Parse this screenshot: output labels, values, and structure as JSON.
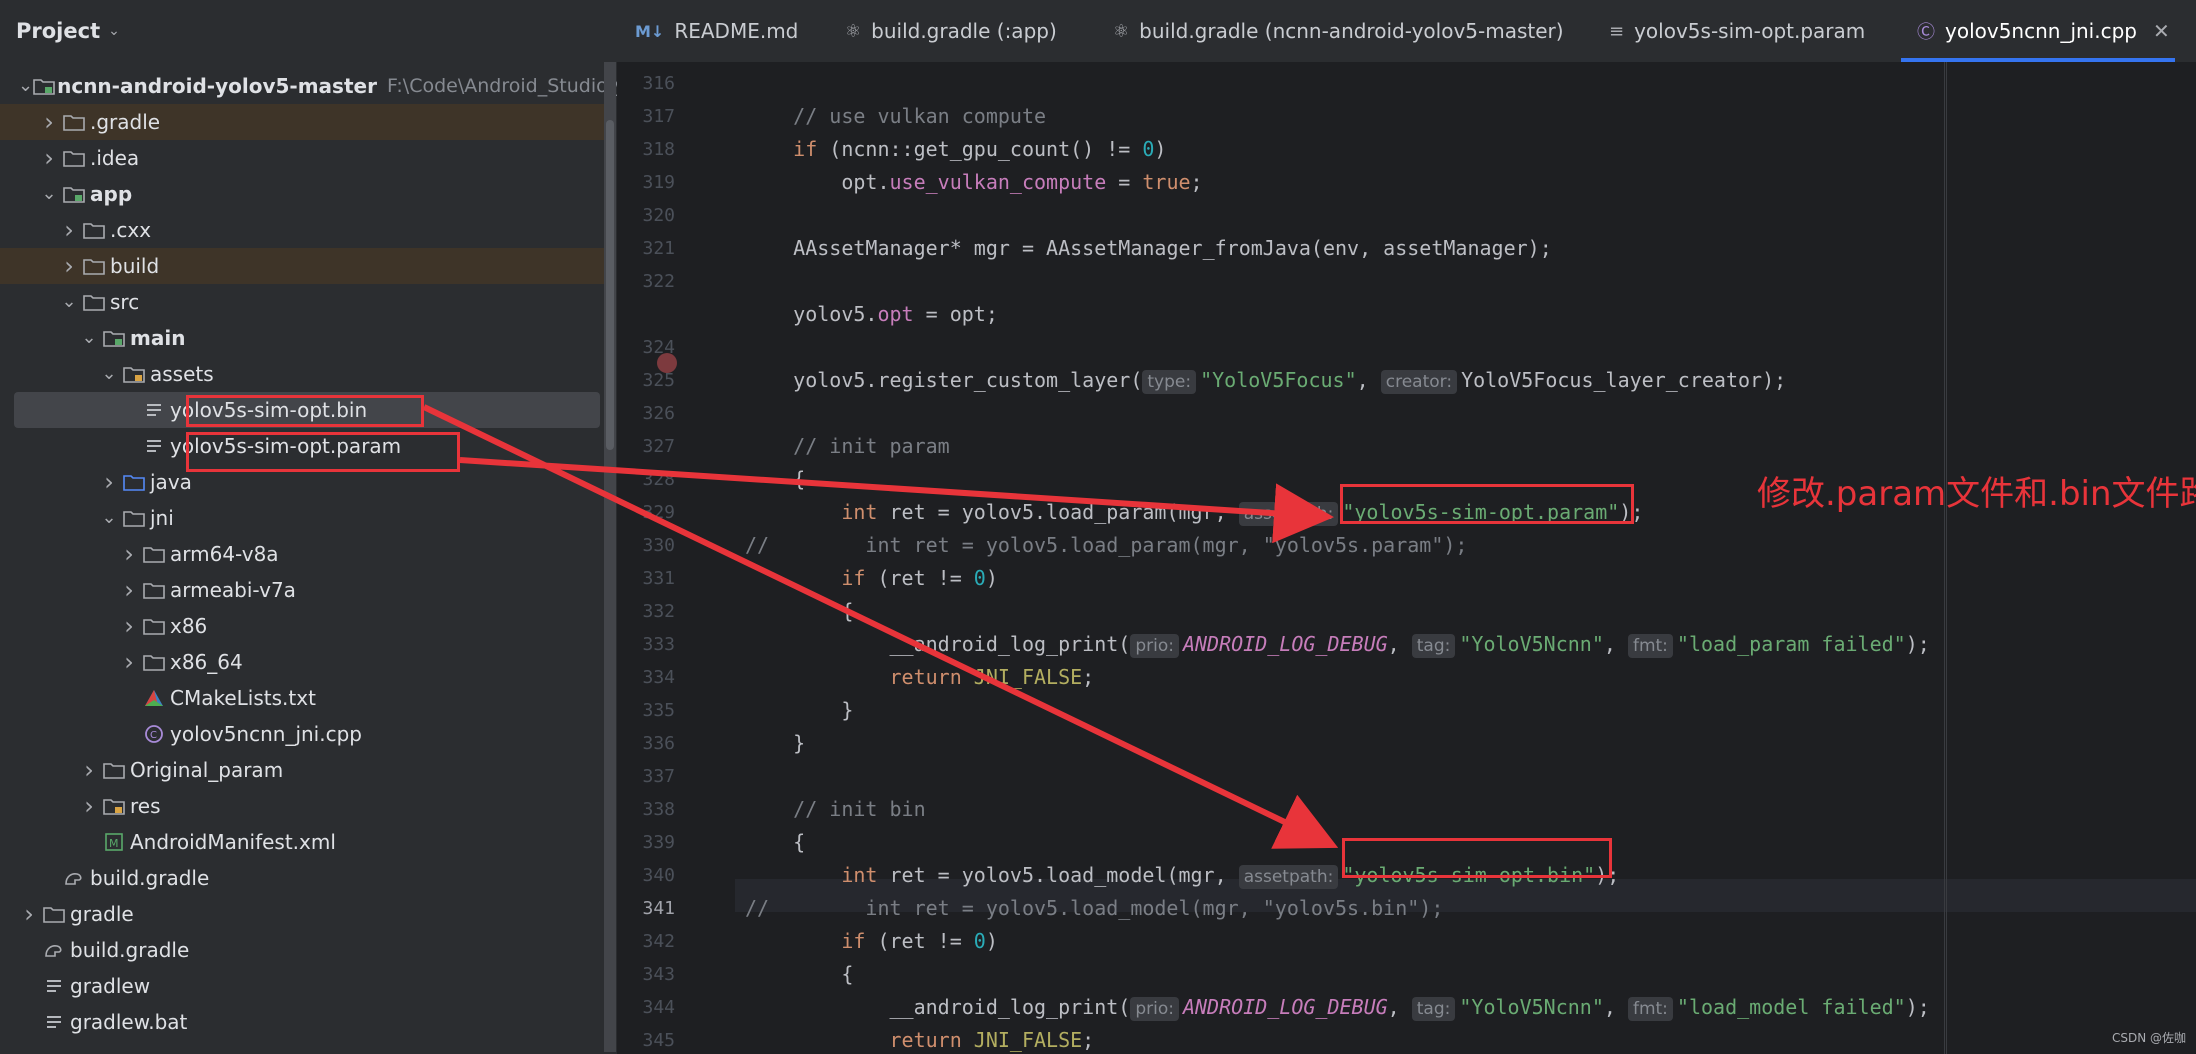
{
  "project": {
    "title": "Project",
    "root_path": "F:\\Code\\Android_Studio\\yolo",
    "tree": [
      {
        "label": "ncnn-android-yolov5-master",
        "arrow": "down",
        "icon": "module-folder-icon"
      },
      {
        "label": ".gradle",
        "arrow": "right",
        "icon": "folder-icon"
      },
      {
        "label": ".idea",
        "arrow": "right",
        "icon": "folder-icon"
      },
      {
        "label": "app",
        "arrow": "down",
        "icon": "module-folder-icon"
      },
      {
        "label": ".cxx",
        "arrow": "right",
        "icon": "folder-icon"
      },
      {
        "label": "build",
        "arrow": "right",
        "icon": "folder-icon"
      },
      {
        "label": "src",
        "arrow": "down",
        "icon": "folder-icon"
      },
      {
        "label": "main",
        "arrow": "down",
        "icon": "module-folder-icon"
      },
      {
        "label": "assets",
        "arrow": "down",
        "icon": "resource-folder-icon"
      },
      {
        "label": "yolov5s-sim-opt.bin",
        "arrow": "",
        "icon": "text-file-icon"
      },
      {
        "label": "yolov5s-sim-opt.param",
        "arrow": "",
        "icon": "text-file-icon"
      },
      {
        "label": "java",
        "arrow": "right",
        "icon": "source-folder-icon"
      },
      {
        "label": "jni",
        "arrow": "down",
        "icon": "folder-icon"
      },
      {
        "label": "arm64-v8a",
        "arrow": "right",
        "icon": "folder-icon"
      },
      {
        "label": "armeabi-v7a",
        "arrow": "right",
        "icon": "folder-icon"
      },
      {
        "label": "x86",
        "arrow": "right",
        "icon": "folder-icon"
      },
      {
        "label": "x86_64",
        "arrow": "right",
        "icon": "folder-icon"
      },
      {
        "label": "CMakeLists.txt",
        "arrow": "",
        "icon": "cmake-icon"
      },
      {
        "label": "yolov5ncnn_jni.cpp",
        "arrow": "",
        "icon": "cpp-file-icon"
      },
      {
        "label": "Original_param",
        "arrow": "right",
        "icon": "folder-icon"
      },
      {
        "label": "res",
        "arrow": "right",
        "icon": "resource-folder-icon"
      },
      {
        "label": "AndroidManifest.xml",
        "arrow": "",
        "icon": "manifest-icon"
      },
      {
        "label": "build.gradle",
        "arrow": "",
        "icon": "gradle-icon"
      },
      {
        "label": "gradle",
        "arrow": "right",
        "icon": "folder-icon"
      },
      {
        "label": "build.gradle",
        "arrow": "",
        "icon": "gradle-icon"
      },
      {
        "label": "gradlew",
        "arrow": "",
        "icon": "text-file-icon"
      },
      {
        "label": "gradlew.bat",
        "arrow": "",
        "icon": "text-file-icon"
      }
    ]
  },
  "tabs": [
    {
      "label": "README.md",
      "icon": "markdown-icon"
    },
    {
      "label": "build.gradle (:app)",
      "icon": "gradle-icon"
    },
    {
      "label": "build.gradle (ncnn-android-yolov5-master)",
      "icon": "gradle-icon"
    },
    {
      "label": "yolov5s-sim-opt.param",
      "icon": "text-file-icon"
    },
    {
      "label": "yolov5ncnn_jni.cpp",
      "icon": "cpp-file-icon"
    }
  ],
  "editor": {
    "line_numbers": [
      "316",
      "317",
      "318",
      "319",
      "320",
      "321",
      "322",
      "",
      "324",
      "325",
      "326",
      "327",
      "328",
      "329",
      "330",
      "331",
      "332",
      "333",
      "334",
      "335",
      "336",
      "337",
      "338",
      "339",
      "340",
      "341",
      "342",
      "343",
      "344",
      "345"
    ],
    "current_line": "341",
    "annotation": "修改.param文件和.bin文件路径",
    "code": {
      "l317": "// use vulkan compute",
      "l318a": "if",
      "l318b": " (ncnn::get_gpu_count() != ",
      "l318c": "0",
      "l318d": ")",
      "l319a": "opt.",
      "l319b": "use_vulkan_compute",
      "l319c": " = ",
      "l319d": "true",
      "l319e": ";",
      "l321": "AAssetManager* mgr = AAssetManager_fromJava(env, assetManager);",
      "l323a": "yolov5.",
      "l323b": "opt",
      "l323c": " = opt;",
      "l325a": "yolov5.register_custom_layer(",
      "l325h1": "type:",
      "l325s1": "\"YoloV5Focus\"",
      "l325b": ", ",
      "l325h2": "creator:",
      "l325c": "YoloV5Focus_layer_creator);",
      "l327": "// init param",
      "l328": "{",
      "l329a": "int",
      "l329b": " ret = yolov5.load_param(mgr, ",
      "l329h": "assetpath:",
      "l329s": "\"yolov5s-sim-opt.param\"",
      "l329c": ");",
      "l330": "//        int ret = yolov5.load_param(mgr, \"yolov5s.param\");",
      "l331a": "if",
      "l331b": " (ret != ",
      "l331c": "0",
      "l331d": ")",
      "l332": "{",
      "l333a": "__android_log_print(",
      "l333h1": "prio:",
      "l333m": "ANDROID_LOG_DEBUG",
      "l333b": ", ",
      "l333h2": "tag:",
      "l333s1": "\"YoloV5Ncnn\"",
      "l333c": ", ",
      "l333h3": "fmt:",
      "l333s2": "\"load_param failed\"",
      "l333d": ");",
      "l334a": "return",
      "l334b": " JNI_FALSE",
      "l334c": ";",
      "l335": "}",
      "l336": "}",
      "l338": "// init bin",
      "l339": "{",
      "l340a": "int",
      "l340b": " ret = yolov5.load_model(mgr, ",
      "l340h": "assetpath:",
      "l340s": "\"yolov5s-sim-opt.bin\"",
      "l340c": ");",
      "l341": "//        int ret = yolov5.load_model(mgr, \"yolov5s.bin\");",
      "l342a": "if",
      "l342b": " (ret != ",
      "l342c": "0",
      "l342d": ")",
      "l343": "{",
      "l344a": "__android_log_print(",
      "l344h1": "prio:",
      "l344m": "ANDROID_LOG_DEBUG",
      "l344b": ", ",
      "l344h2": "tag:",
      "l344s1": "\"YoloV5Ncnn\"",
      "l344c": ", ",
      "l344h3": "fmt:",
      "l344s2": "\"load_model failed\"",
      "l344d": ");",
      "l345a": "return",
      "l345b": " JNI_FALSE",
      "l345c": ";"
    }
  },
  "watermark": "CSDN @佐咖",
  "colors": {
    "accent": "#3574f0",
    "annotation_red": "#e8343a",
    "highlight_row": "#3e3428"
  }
}
